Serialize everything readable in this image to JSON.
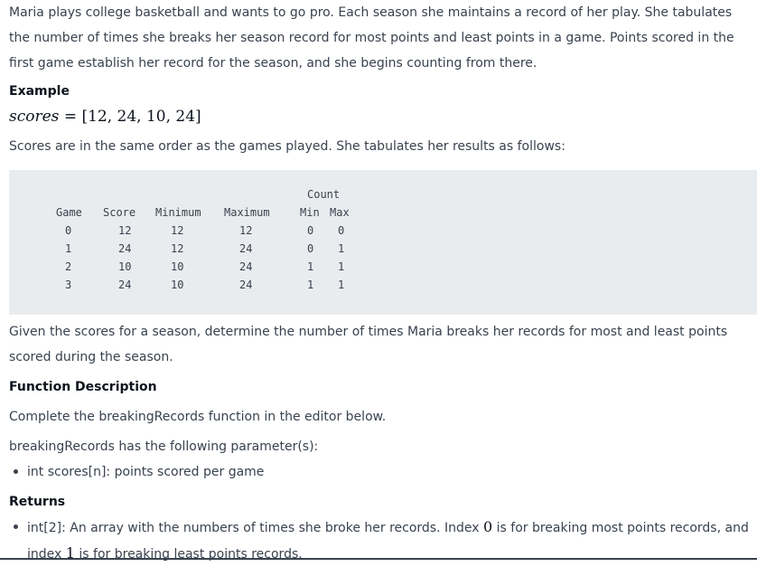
{
  "intro": "Maria plays college basketball and wants to go pro. Each season she maintains a record of her play. She tabulates the number of times she breaks her season record for most points and least points in a game. Points scored in the first game establish her record for the season, and she begins counting from there.",
  "example_heading": "Example",
  "example_formula": {
    "var": "scores",
    "equals": "=",
    "value": "[12, 24, 10, 24]"
  },
  "order_text": "Scores are in the same order as the games played. She tabulates her results as follows:",
  "table": {
    "count_header": "Count",
    "headers": [
      "Game",
      "Score",
      "Minimum",
      "Maximum",
      "Min",
      "Max"
    ],
    "rows": [
      [
        "0",
        "12",
        "12",
        "12",
        "0",
        "0"
      ],
      [
        "1",
        "24",
        "12",
        "24",
        "0",
        "1"
      ],
      [
        "2",
        "10",
        "10",
        "24",
        "1",
        "1"
      ],
      [
        "3",
        "24",
        "10",
        "24",
        "1",
        "1"
      ]
    ]
  },
  "given_text": "Given the scores for a season, determine the number of times Maria breaks her records for most and least points scored during the season.",
  "function_heading": "Function Description",
  "function_text": "Complete the breakingRecords function in the editor below.",
  "params_text": "breakingRecords has the following parameter(s):",
  "params": [
    "int scores[n]: points scored per game"
  ],
  "returns_heading": "Returns",
  "returns": {
    "prefix": "int[2]: An array with the numbers of times she broke her records. Index ",
    "index0": "0",
    "middle": " is for breaking most points records, and index ",
    "index1": "1",
    "suffix": " is for breaking least points records."
  }
}
